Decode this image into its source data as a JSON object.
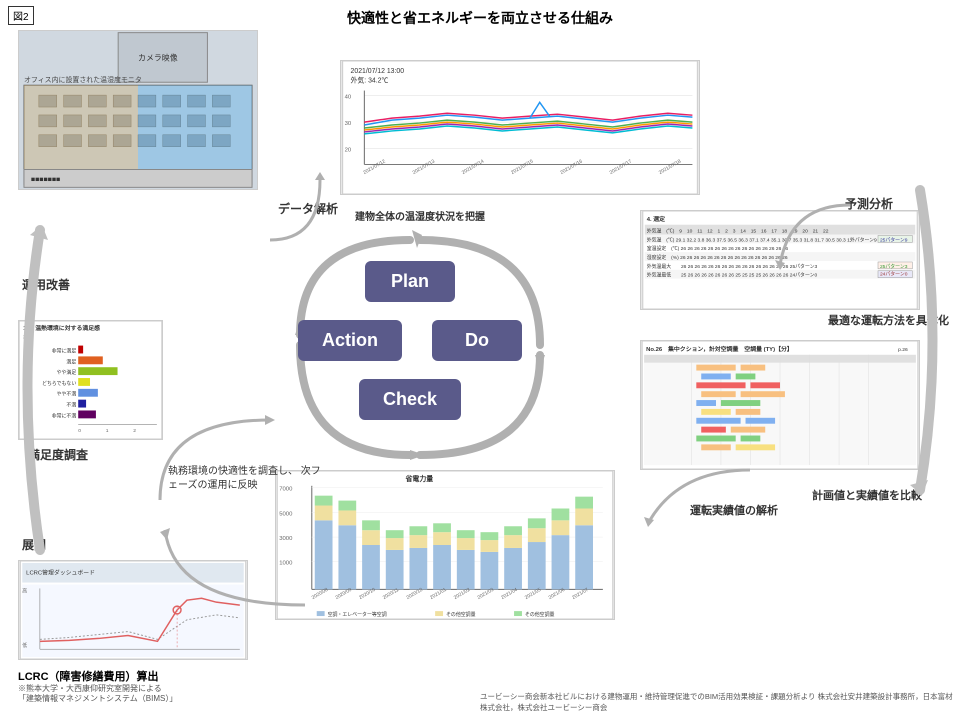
{
  "figure_label": "図2",
  "main_title": "快適性と省エネルギーを両立させる仕組み",
  "pdca": {
    "plan": "Plan",
    "action": "Action",
    "do": "Do",
    "check": "Check"
  },
  "labels": {
    "data_analysis": "データ解析",
    "prediction_analysis": "予測分析",
    "optimal_operation": "最適な運転方法を具体化",
    "compare_plan_actual": "計画値と実績値を比較",
    "operation_actual_analysis": "運転実績値の解析",
    "satisfaction_survey": "満足度調査",
    "operation_improvement": "運用改善",
    "deploy": "展開",
    "building_temperature": "建物全体の温湿度状況を把握",
    "phase_reflection": "執務環境の快適性を調査し、\n次フェーズの運用に反映",
    "lcrc_title": "LCRC（障害修繕費用）算出",
    "footnote1": "※熊本大学・大西康仰研究室開発による",
    "footnote2": "「建築情報マネジメントシステム（BIMS）」",
    "credit": "ユービーシー商会新本社ビルにおける建物運用・維持管理促進でのBIM活用効果検証・課題分析より\n株式会社安井建築設計事務所，日本富材株式会社，株式会社ユービーシー商会"
  },
  "temp_graph": {
    "title": "2021/07/12 13:00",
    "subtitle": "外気: 34.2℃",
    "x_labels": [
      "2021/07/12",
      "2021/07/13",
      "2021/07/14",
      "2021/07/15",
      "2021/07/16",
      "2021/07/17",
      "2021/07/18"
    ],
    "y_min": 20,
    "y_max": 40
  },
  "energy_chart": {
    "title": "省電力量",
    "y_max": 7000,
    "x_labels": [
      "2020/08",
      "2020/09",
      "2020/10",
      "2020/11",
      "2020/12",
      "2021/01",
      "2021/02",
      "2021/03",
      "2021/04",
      "2021/05",
      "2021/06",
      "2021/07"
    ],
    "legend": [
      "空調・エレベーター等空調",
      "その他空調量"
    ]
  },
  "satisfaction_legend": [
    {
      "color": "#c00000",
      "label": "非常に満足"
    },
    {
      "color": "#e06020",
      "label": "満足"
    },
    {
      "color": "#90c020",
      "label": "やや満足"
    },
    {
      "color": "#e0e020",
      "label": "どちらでもない"
    },
    {
      "color": "#6090e0",
      "label": "やや不満"
    },
    {
      "color": "#2020a0",
      "label": "不満"
    },
    {
      "color": "#600060",
      "label": "非常に不満"
    }
  ],
  "colors": {
    "pdca_bg": "#5a5a8a",
    "arrow_color": "#aaaaaa",
    "accent": "#4a90d9"
  }
}
